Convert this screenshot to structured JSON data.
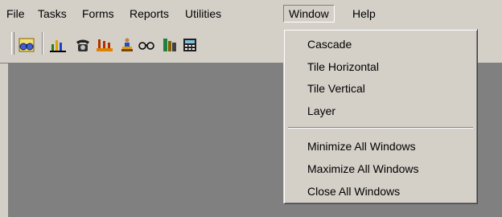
{
  "menubar": {
    "items": [
      "File",
      "Tasks",
      "Forms",
      "Reports",
      "Utilities",
      "Window",
      "Help"
    ],
    "active": "Window"
  },
  "toolbar": {
    "buttons": [
      "binoculars-icon",
      "chart-icon",
      "telephone-icon",
      "factory-icon",
      "person-icon",
      "glasses-icon",
      "bookcase-icon",
      "calculator-icon"
    ]
  },
  "window_menu": {
    "groups": [
      [
        "Cascade",
        "Tile Horizontal",
        "Tile Vertical",
        "Layer"
      ],
      [
        "Minimize All Windows",
        "Maximize All Windows",
        "Close All Windows"
      ]
    ]
  },
  "colors": {
    "face": "#d4d0c8",
    "workspace": "#808080",
    "shadow": "#808080",
    "highlight": "#ffffff"
  }
}
